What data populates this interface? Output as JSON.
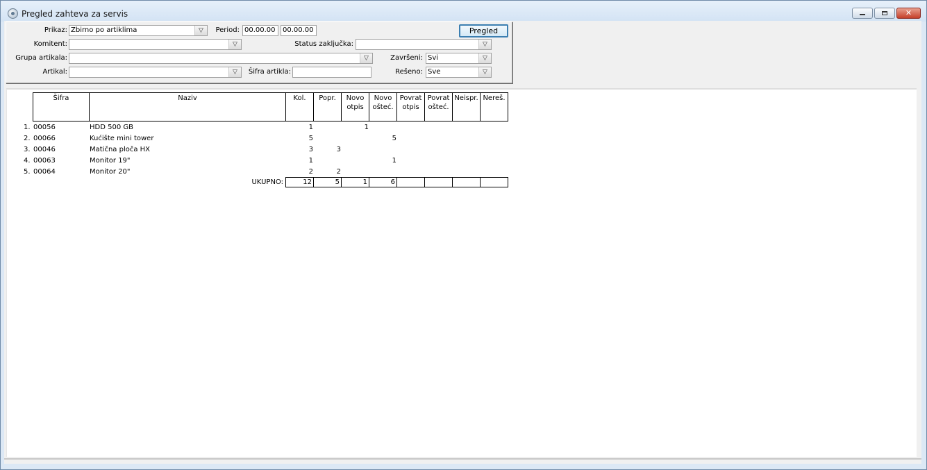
{
  "window": {
    "title": "Pregled zahteva za servis",
    "controls": {
      "minimize": "",
      "maximize": "",
      "close": "✕"
    }
  },
  "filters": {
    "prikaz": {
      "label": "Prikaz:",
      "value": "Zbirno po artiklima"
    },
    "period": {
      "label": "Period:",
      "from": "00.00.00",
      "to": "00.00.00"
    },
    "komitent": {
      "label": "Komitent:",
      "value": ""
    },
    "status_zakljucka": {
      "label": "Status zaključka:",
      "value": ""
    },
    "grupa_artikala": {
      "label": "Grupa artikala:",
      "value": ""
    },
    "zavrseni": {
      "label": "Završeni:",
      "value": "Svi"
    },
    "artikal": {
      "label": "Artikal:",
      "value": ""
    },
    "sifra_artikla": {
      "label": "Šifra artikla:",
      "value": ""
    },
    "reseno": {
      "label": "Rešeno:",
      "value": "Sve"
    },
    "pregled_button": "Pregled"
  },
  "table": {
    "headers": {
      "sifra": "Šifra",
      "naziv": "Naziv",
      "kol": "Kol.",
      "popr": "Popr.",
      "novo_otpis_1": "Novo",
      "novo_otpis_2": "otpis",
      "novo_ostec_1": "Novo",
      "novo_ostec_2": "ošteć.",
      "povrat_otpis_1": "Povrat",
      "povrat_otpis_2": "otpis",
      "povrat_ostec_1": "Povrat",
      "povrat_ostec_2": "ošteć.",
      "neispr": "Neispr.",
      "neres": "Nereš."
    },
    "rows": [
      {
        "rb": "1.",
        "sifra": "00056",
        "naziv": "HDD 500 GB",
        "kol": "1",
        "popr": "",
        "novo_otpis": "1",
        "novo_ostec": ""
      },
      {
        "rb": "2.",
        "sifra": "00066",
        "naziv": "Kućište mini tower",
        "kol": "5",
        "popr": "",
        "novo_otpis": "",
        "novo_ostec": "5"
      },
      {
        "rb": "3.",
        "sifra": "00046",
        "naziv": "Matična ploča HX",
        "kol": "3",
        "popr": "3",
        "novo_otpis": "",
        "novo_ostec": ""
      },
      {
        "rb": "4.",
        "sifra": "00063",
        "naziv": "Monitor 19\"",
        "kol": "1",
        "popr": "",
        "novo_otpis": "",
        "novo_ostec": "1"
      },
      {
        "rb": "5.",
        "sifra": "00064",
        "naziv": "Monitor 20\"",
        "kol": "2",
        "popr": "2",
        "novo_otpis": "",
        "novo_ostec": ""
      }
    ],
    "totals": {
      "label": "UKUPNO:",
      "kol": "12",
      "popr": "5",
      "novo_otpis": "1",
      "novo_ostec": "6",
      "povrat_otpis": "",
      "povrat_ostec": "",
      "neispr": "",
      "neres": ""
    }
  }
}
